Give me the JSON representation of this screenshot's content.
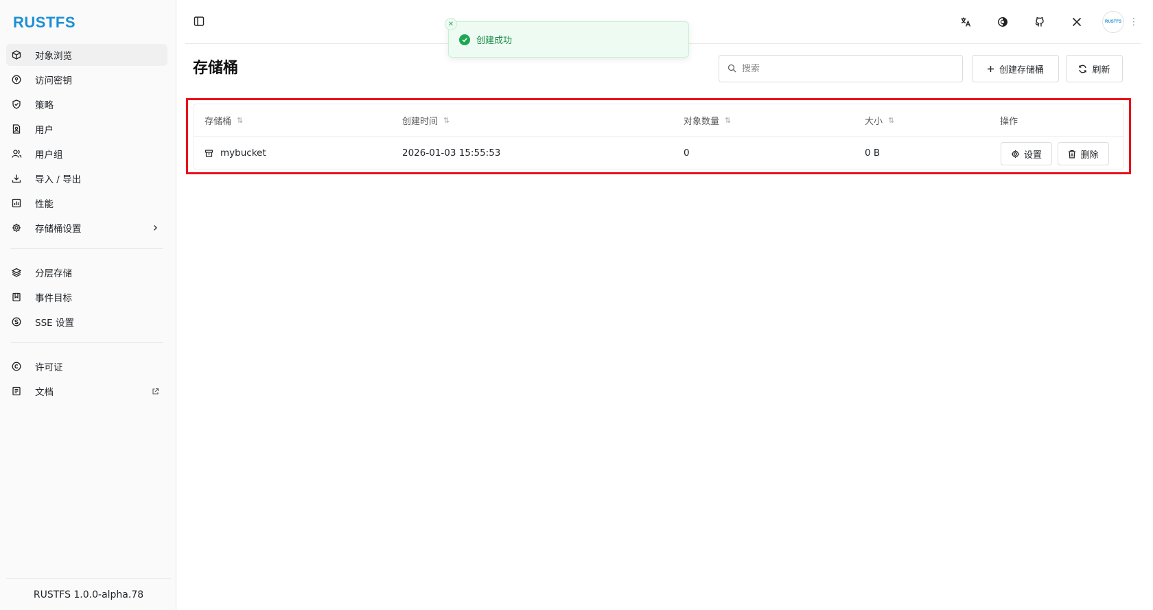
{
  "brand": {
    "logo_text": "RUSTFS",
    "accent_color": "#1a8fd6"
  },
  "sidebar": {
    "items": [
      {
        "label": "对象浏览",
        "icon": "cube-icon",
        "active": true
      },
      {
        "label": "访问密钥",
        "icon": "key-circle-icon"
      },
      {
        "label": "策略",
        "icon": "shield-icon"
      },
      {
        "label": "用户",
        "icon": "user-file-icon"
      },
      {
        "label": "用户组",
        "icon": "users-icon"
      },
      {
        "label": "导入 / 导出",
        "icon": "download-icon"
      },
      {
        "label": "性能",
        "icon": "chart-icon"
      },
      {
        "label": "存储桶设置",
        "icon": "gear-icon",
        "trail_icon": "chevron-right-icon"
      }
    ],
    "items2": [
      {
        "label": "分层存储",
        "icon": "layers-icon"
      },
      {
        "label": "事件目标",
        "icon": "bookmark-icon"
      },
      {
        "label": "SSE 设置",
        "icon": "coin-icon"
      }
    ],
    "items3": [
      {
        "label": "许可证",
        "icon": "copyright-icon"
      },
      {
        "label": "文档",
        "icon": "document-icon",
        "trail_icon": "external-link-icon"
      }
    ],
    "version": "RUSTFS 1.0.0-alpha.78"
  },
  "header": {
    "icons": [
      "translate-icon",
      "theme-icon",
      "github-icon",
      "x-logo-icon"
    ],
    "avatar_text": "RUSTFS"
  },
  "page": {
    "title": "存储桶",
    "search_placeholder": "搜索",
    "create_label": "创建存储桶",
    "refresh_label": "刷新"
  },
  "toast": {
    "message": "创建成功",
    "status_color": "#1ea653"
  },
  "table": {
    "columns": [
      "存储桶",
      "创建时间",
      "对象数量",
      "大小",
      "操作"
    ],
    "rows": [
      {
        "name": "mybucket",
        "created": "2026-01-03 15:55:53",
        "objects": "0",
        "size": "0 B",
        "settings_label": "设置",
        "delete_label": "删除"
      }
    ],
    "highlight_color": "#e8101a"
  }
}
